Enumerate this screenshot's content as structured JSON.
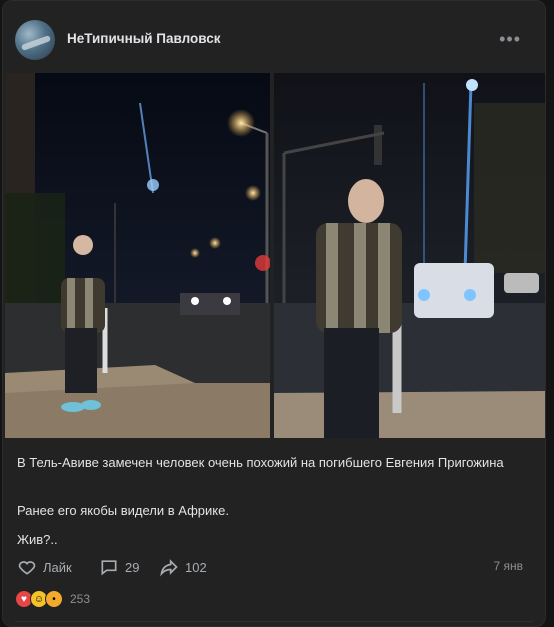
{
  "post": {
    "author": "НеТипичный Павловск",
    "more_icon": "more-horizontal-icon",
    "text_line1": "В Тель-Авиве замечен человек очень похожий на погибшего Евгения Пригожина",
    "text_line2": "Ранее его якобы видели в Африке.",
    "text_line3": "Жив?..",
    "actions": {
      "like_label": "Лайк",
      "comments_count": "29",
      "shares_count": "102"
    },
    "date": "7 янв",
    "reactions_count": "253"
  },
  "colors": {
    "background": "#222222",
    "text": "#e1e3e6",
    "muted": "#8b8f94",
    "heart": "#e64646"
  }
}
